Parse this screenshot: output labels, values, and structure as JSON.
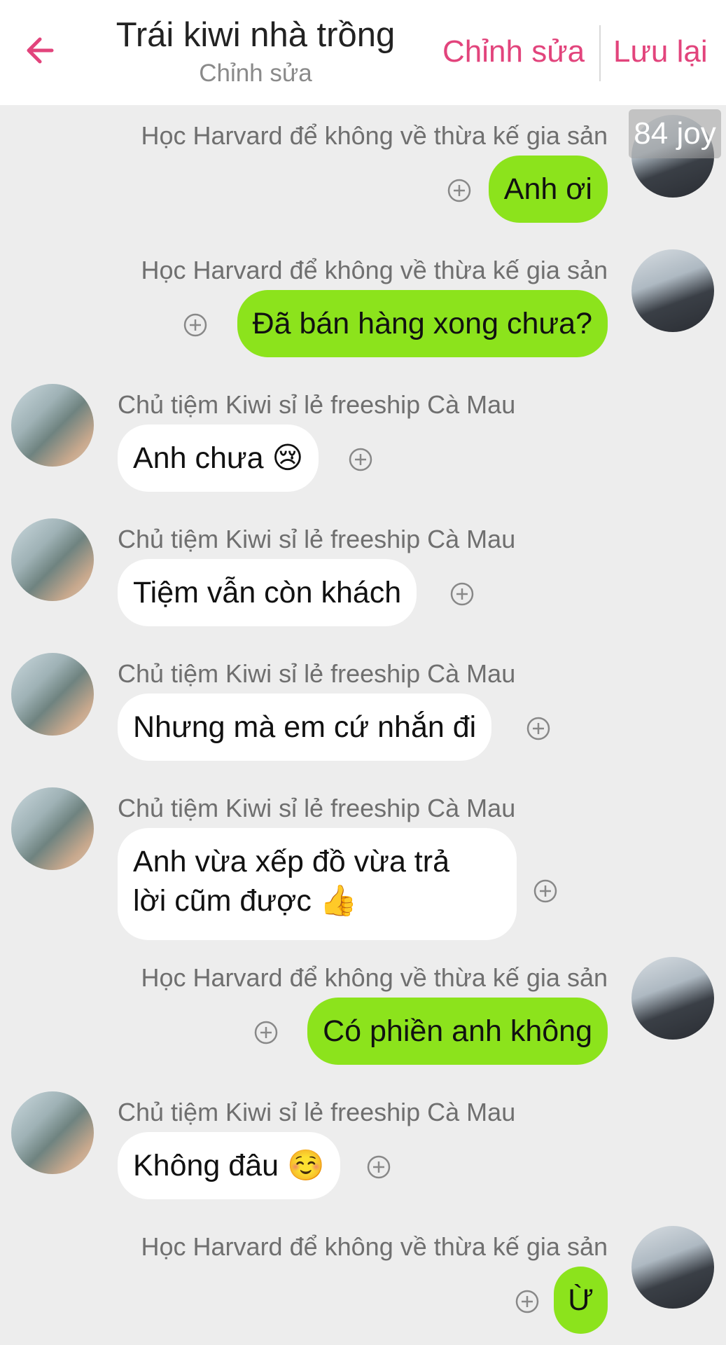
{
  "header": {
    "title": "Trái kiwi nhà trồng",
    "subtitle": "Chỉnh sửa",
    "edit_label": "Chỉnh sửa",
    "save_label": "Lưu lại",
    "accent_color": "#e2447c"
  },
  "badge": {
    "text": "84 joy"
  },
  "colors": {
    "sent_bubble": "#8ce31c",
    "received_bubble": "#ffffff",
    "background": "#ededed"
  },
  "icons": {
    "back": "arrow-left-icon",
    "add": "plus-circle-icon"
  },
  "messages": [
    {
      "side": "right",
      "sender": "Học Harvard để không về thừa kế gia sản",
      "text": "Anh ơi"
    },
    {
      "side": "right",
      "sender": "Học Harvard để không về thừa kế gia sản",
      "text": "Đã bán hàng xong chưa?"
    },
    {
      "side": "left",
      "sender": "Chủ tiệm Kiwi sỉ lẻ freeship Cà Mau",
      "text": "Anh chưa 😢"
    },
    {
      "side": "left",
      "sender": "Chủ tiệm Kiwi sỉ lẻ freeship Cà Mau",
      "text": "Tiệm vẫn còn khách"
    },
    {
      "side": "left",
      "sender": "Chủ tiệm Kiwi sỉ lẻ freeship Cà Mau",
      "text": "Nhưng mà em cứ nhắn đi"
    },
    {
      "side": "left",
      "sender": "Chủ tiệm Kiwi sỉ lẻ freeship Cà Mau",
      "text_line1": "Anh vừa xếp đồ vừa trả",
      "text_line2": "lời cũm được 👍"
    },
    {
      "side": "right",
      "sender": "Học Harvard để không về thừa kế gia sản",
      "text": "Có phiền anh không"
    },
    {
      "side": "left",
      "sender": "Chủ tiệm Kiwi sỉ lẻ freeship Cà Mau",
      "text": "Không đâu ☺️"
    },
    {
      "side": "right",
      "sender": "Học Harvard để không về thừa kế gia sản",
      "text": "Ừ"
    }
  ]
}
